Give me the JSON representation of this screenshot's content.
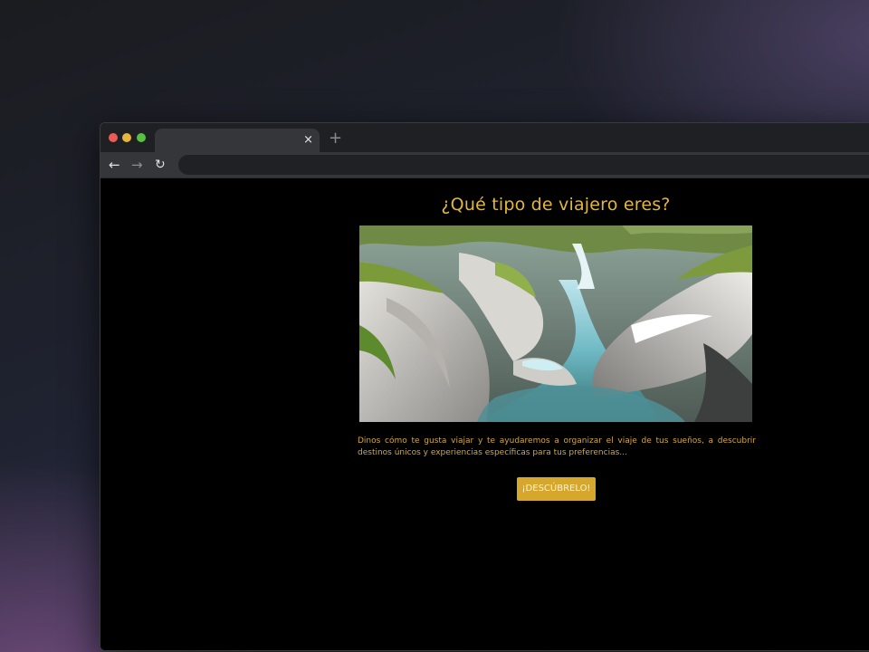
{
  "browser": {
    "tab_title": "",
    "tab_close_label": "×",
    "new_tab_label": "+",
    "back_label": "←",
    "forward_label": "→",
    "reload_label": "↻",
    "address_value": ""
  },
  "page": {
    "title": "¿Qué tipo de viajero eres?",
    "description": "Dinos cómo te gusta viajar y te ayudaremos a organizar el viaje de tus sueños, a descubrir destinos únicos y experiencias específicas para tus preferencias...",
    "cta_label": "¡DESCÚBRELO!"
  },
  "colors": {
    "accent": "#e2b73a",
    "button_bg": "#d5a72c",
    "page_bg": "#000000"
  },
  "icons": {
    "close": "close-icon",
    "new_tab": "plus-icon",
    "back": "arrow-left-icon",
    "forward": "arrow-right-icon",
    "reload": "reload-icon"
  }
}
